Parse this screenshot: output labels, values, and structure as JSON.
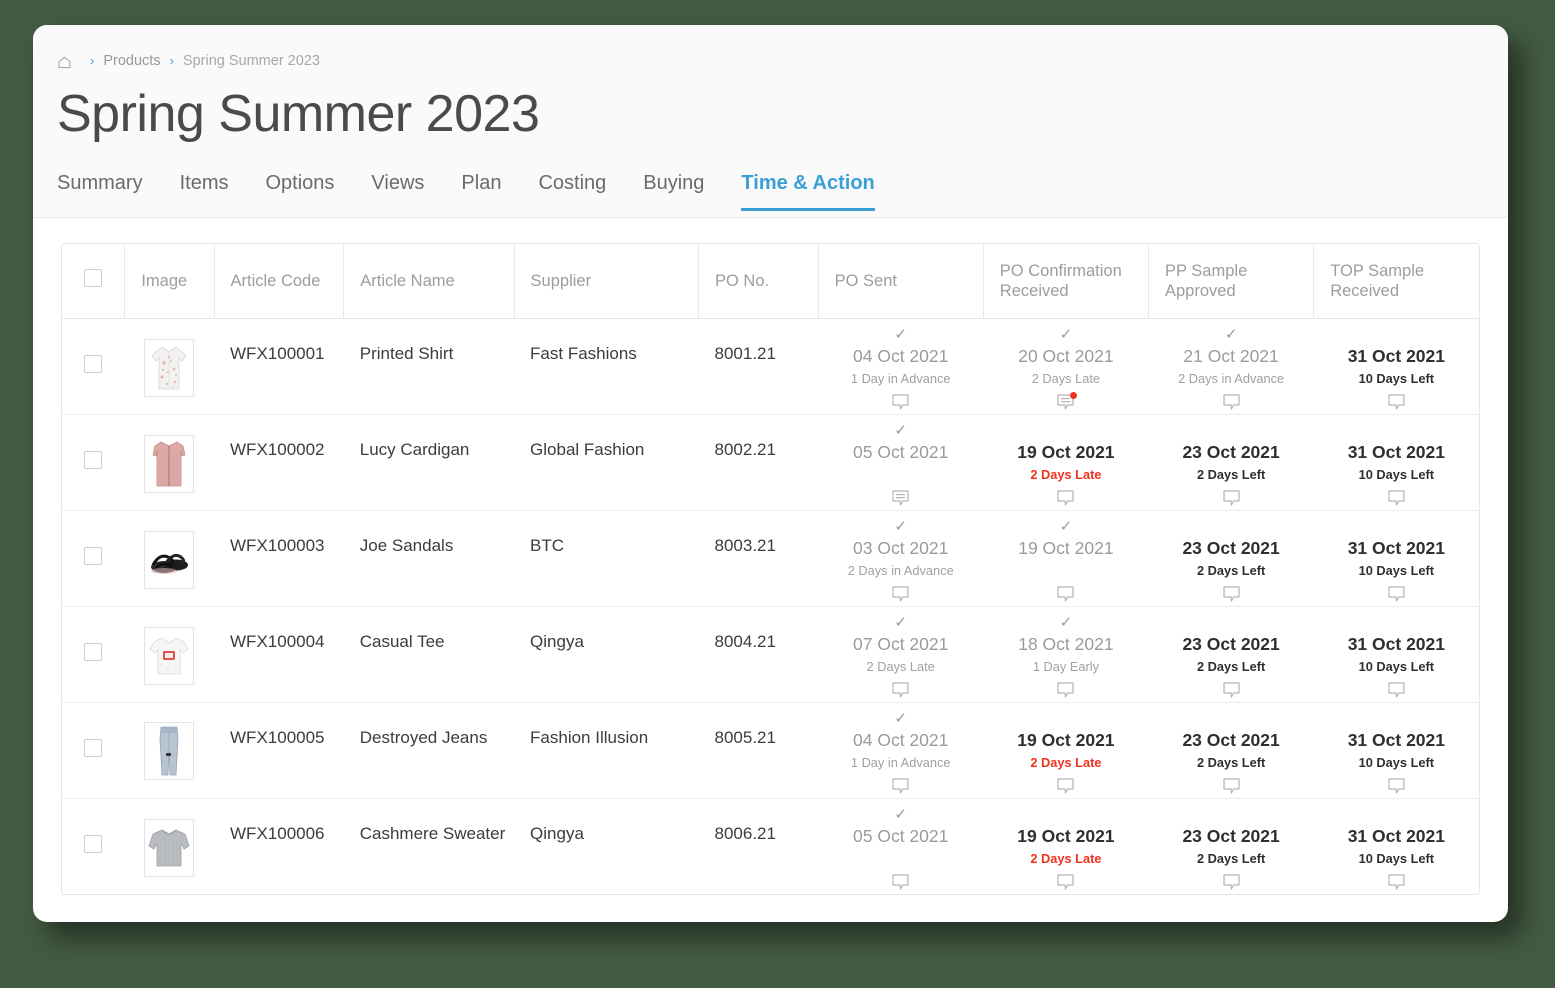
{
  "theme": {
    "background": "#435b42",
    "accent": "#3a9fd4",
    "late_color": "#f0321e",
    "muted_text": "#9b9b9b"
  },
  "breadcrumb": {
    "home_icon": "home-icon",
    "separator": ">",
    "items": [
      {
        "label": "Products"
      },
      {
        "label": "Spring Summer 2023"
      }
    ]
  },
  "header": {
    "title": "Spring Summer 2023"
  },
  "tabs": [
    {
      "label": "Summary",
      "active": false
    },
    {
      "label": "Items",
      "active": false
    },
    {
      "label": "Options",
      "active": false
    },
    {
      "label": "Views",
      "active": false
    },
    {
      "label": "Plan",
      "active": false
    },
    {
      "label": "Costing",
      "active": false
    },
    {
      "label": "Buying",
      "active": false
    },
    {
      "label": "Time & Action",
      "active": true
    }
  ],
  "table": {
    "select_all_checked": false,
    "columns": [
      {
        "key": "check",
        "label": ""
      },
      {
        "key": "image",
        "label": "Image"
      },
      {
        "key": "code",
        "label": "Article Code"
      },
      {
        "key": "name",
        "label": "Article Name"
      },
      {
        "key": "supp",
        "label": "Supplier"
      },
      {
        "key": "po",
        "label": "PO No."
      },
      {
        "key": "ms0",
        "label": "PO Sent"
      },
      {
        "key": "ms1",
        "label": "PO Confirmation Received"
      },
      {
        "key": "ms2",
        "label": "PP Sample Approved"
      },
      {
        "key": "ms3",
        "label": "TOP Sample Received"
      }
    ],
    "rows": [
      {
        "checked": false,
        "image": "printed-shirt",
        "code": "WFX100001",
        "name": "Printed Shirt",
        "supplier": "Fast Fashions",
        "po_no": "8001.21",
        "milestones": [
          {
            "tick": true,
            "date": "04 Oct 2021",
            "state": "done",
            "sub": "1 Day in Advance",
            "sub_style": "muted",
            "comment": "empty",
            "alert": false
          },
          {
            "tick": true,
            "date": "20 Oct 2021",
            "state": "done",
            "sub": "2 Days Late",
            "sub_style": "muted",
            "comment": "filled",
            "alert": true
          },
          {
            "tick": true,
            "date": "21 Oct 2021",
            "state": "done",
            "sub": "2 Days in Advance",
            "sub_style": "muted",
            "comment": "empty",
            "alert": false
          },
          {
            "tick": false,
            "date": "31 Oct 2021",
            "state": "future",
            "sub": "10 Days Left",
            "sub_style": "bold",
            "comment": "empty",
            "alert": false
          }
        ]
      },
      {
        "checked": false,
        "image": "pink-cardigan",
        "code": "WFX100002",
        "name": "Lucy Cardigan",
        "supplier": "Global Fashion",
        "po_no": "8002.21",
        "milestones": [
          {
            "tick": true,
            "date": "05 Oct 2021",
            "state": "done",
            "sub": "",
            "sub_style": "empty",
            "comment": "filled",
            "alert": false
          },
          {
            "tick": false,
            "date": "19 Oct 2021",
            "state": "future",
            "sub": "2 Days Late",
            "sub_style": "late",
            "comment": "empty",
            "alert": false
          },
          {
            "tick": false,
            "date": "23 Oct 2021",
            "state": "future",
            "sub": "2 Days Left",
            "sub_style": "bold",
            "comment": "empty",
            "alert": false
          },
          {
            "tick": false,
            "date": "31 Oct 2021",
            "state": "future",
            "sub": "10 Days Left",
            "sub_style": "bold",
            "comment": "empty",
            "alert": false
          }
        ]
      },
      {
        "checked": false,
        "image": "black-sandals",
        "code": "WFX100003",
        "name": "Joe Sandals",
        "supplier": "BTC",
        "po_no": "8003.21",
        "milestones": [
          {
            "tick": true,
            "date": "03 Oct 2021",
            "state": "done",
            "sub": "2 Days in Advance",
            "sub_style": "muted",
            "comment": "empty",
            "alert": false
          },
          {
            "tick": true,
            "date": "19 Oct 2021",
            "state": "done",
            "sub": "",
            "sub_style": "empty",
            "comment": "empty",
            "alert": false
          },
          {
            "tick": false,
            "date": "23 Oct 2021",
            "state": "future",
            "sub": "2 Days Left",
            "sub_style": "bold",
            "comment": "empty",
            "alert": false
          },
          {
            "tick": false,
            "date": "31 Oct 2021",
            "state": "future",
            "sub": "10 Days Left",
            "sub_style": "bold",
            "comment": "empty",
            "alert": false
          }
        ]
      },
      {
        "checked": false,
        "image": "casual-tee",
        "code": "WFX100004",
        "name": "Casual Tee",
        "supplier": "Qingya",
        "po_no": "8004.21",
        "milestones": [
          {
            "tick": true,
            "date": "07 Oct 2021",
            "state": "done",
            "sub": "2 Days Late",
            "sub_style": "muted",
            "comment": "empty",
            "alert": false
          },
          {
            "tick": true,
            "date": "18 Oct 2021",
            "state": "done",
            "sub": "1 Day Early",
            "sub_style": "muted",
            "comment": "empty",
            "alert": false
          },
          {
            "tick": false,
            "date": "23 Oct 2021",
            "state": "future",
            "sub": "2 Days Left",
            "sub_style": "bold",
            "comment": "empty",
            "alert": false
          },
          {
            "tick": false,
            "date": "31 Oct 2021",
            "state": "future",
            "sub": "10 Days Left",
            "sub_style": "bold",
            "comment": "empty",
            "alert": false
          }
        ]
      },
      {
        "checked": false,
        "image": "destroyed-jeans",
        "code": "WFX100005",
        "name": "Destroyed Jeans",
        "supplier": "Fashion Illusion",
        "po_no": "8005.21",
        "milestones": [
          {
            "tick": true,
            "date": "04 Oct 2021",
            "state": "done",
            "sub": "1 Day in Advance",
            "sub_style": "muted",
            "comment": "empty",
            "alert": false
          },
          {
            "tick": false,
            "date": "19 Oct 2021",
            "state": "future",
            "sub": "2 Days Late",
            "sub_style": "late",
            "comment": "empty",
            "alert": false
          },
          {
            "tick": false,
            "date": "23 Oct 2021",
            "state": "future",
            "sub": "2 Days Left",
            "sub_style": "bold",
            "comment": "empty",
            "alert": false
          },
          {
            "tick": false,
            "date": "31 Oct 2021",
            "state": "future",
            "sub": "10 Days Left",
            "sub_style": "bold",
            "comment": "empty",
            "alert": false
          }
        ]
      },
      {
        "checked": false,
        "image": "cashmere-sweater",
        "code": "WFX100006",
        "name": "Cashmere Sweater",
        "supplier": "Qingya",
        "po_no": "8006.21",
        "milestones": [
          {
            "tick": true,
            "date": "05 Oct 2021",
            "state": "done",
            "sub": "",
            "sub_style": "empty",
            "comment": "empty",
            "alert": false
          },
          {
            "tick": false,
            "date": "19 Oct 2021",
            "state": "future",
            "sub": "2 Days Late",
            "sub_style": "late",
            "comment": "empty",
            "alert": false
          },
          {
            "tick": false,
            "date": "23 Oct 2021",
            "state": "future",
            "sub": "2 Days Left",
            "sub_style": "bold",
            "comment": "empty",
            "alert": false
          },
          {
            "tick": false,
            "date": "31 Oct 2021",
            "state": "future",
            "sub": "10 Days Left",
            "sub_style": "bold",
            "comment": "empty",
            "alert": false
          }
        ]
      }
    ]
  }
}
